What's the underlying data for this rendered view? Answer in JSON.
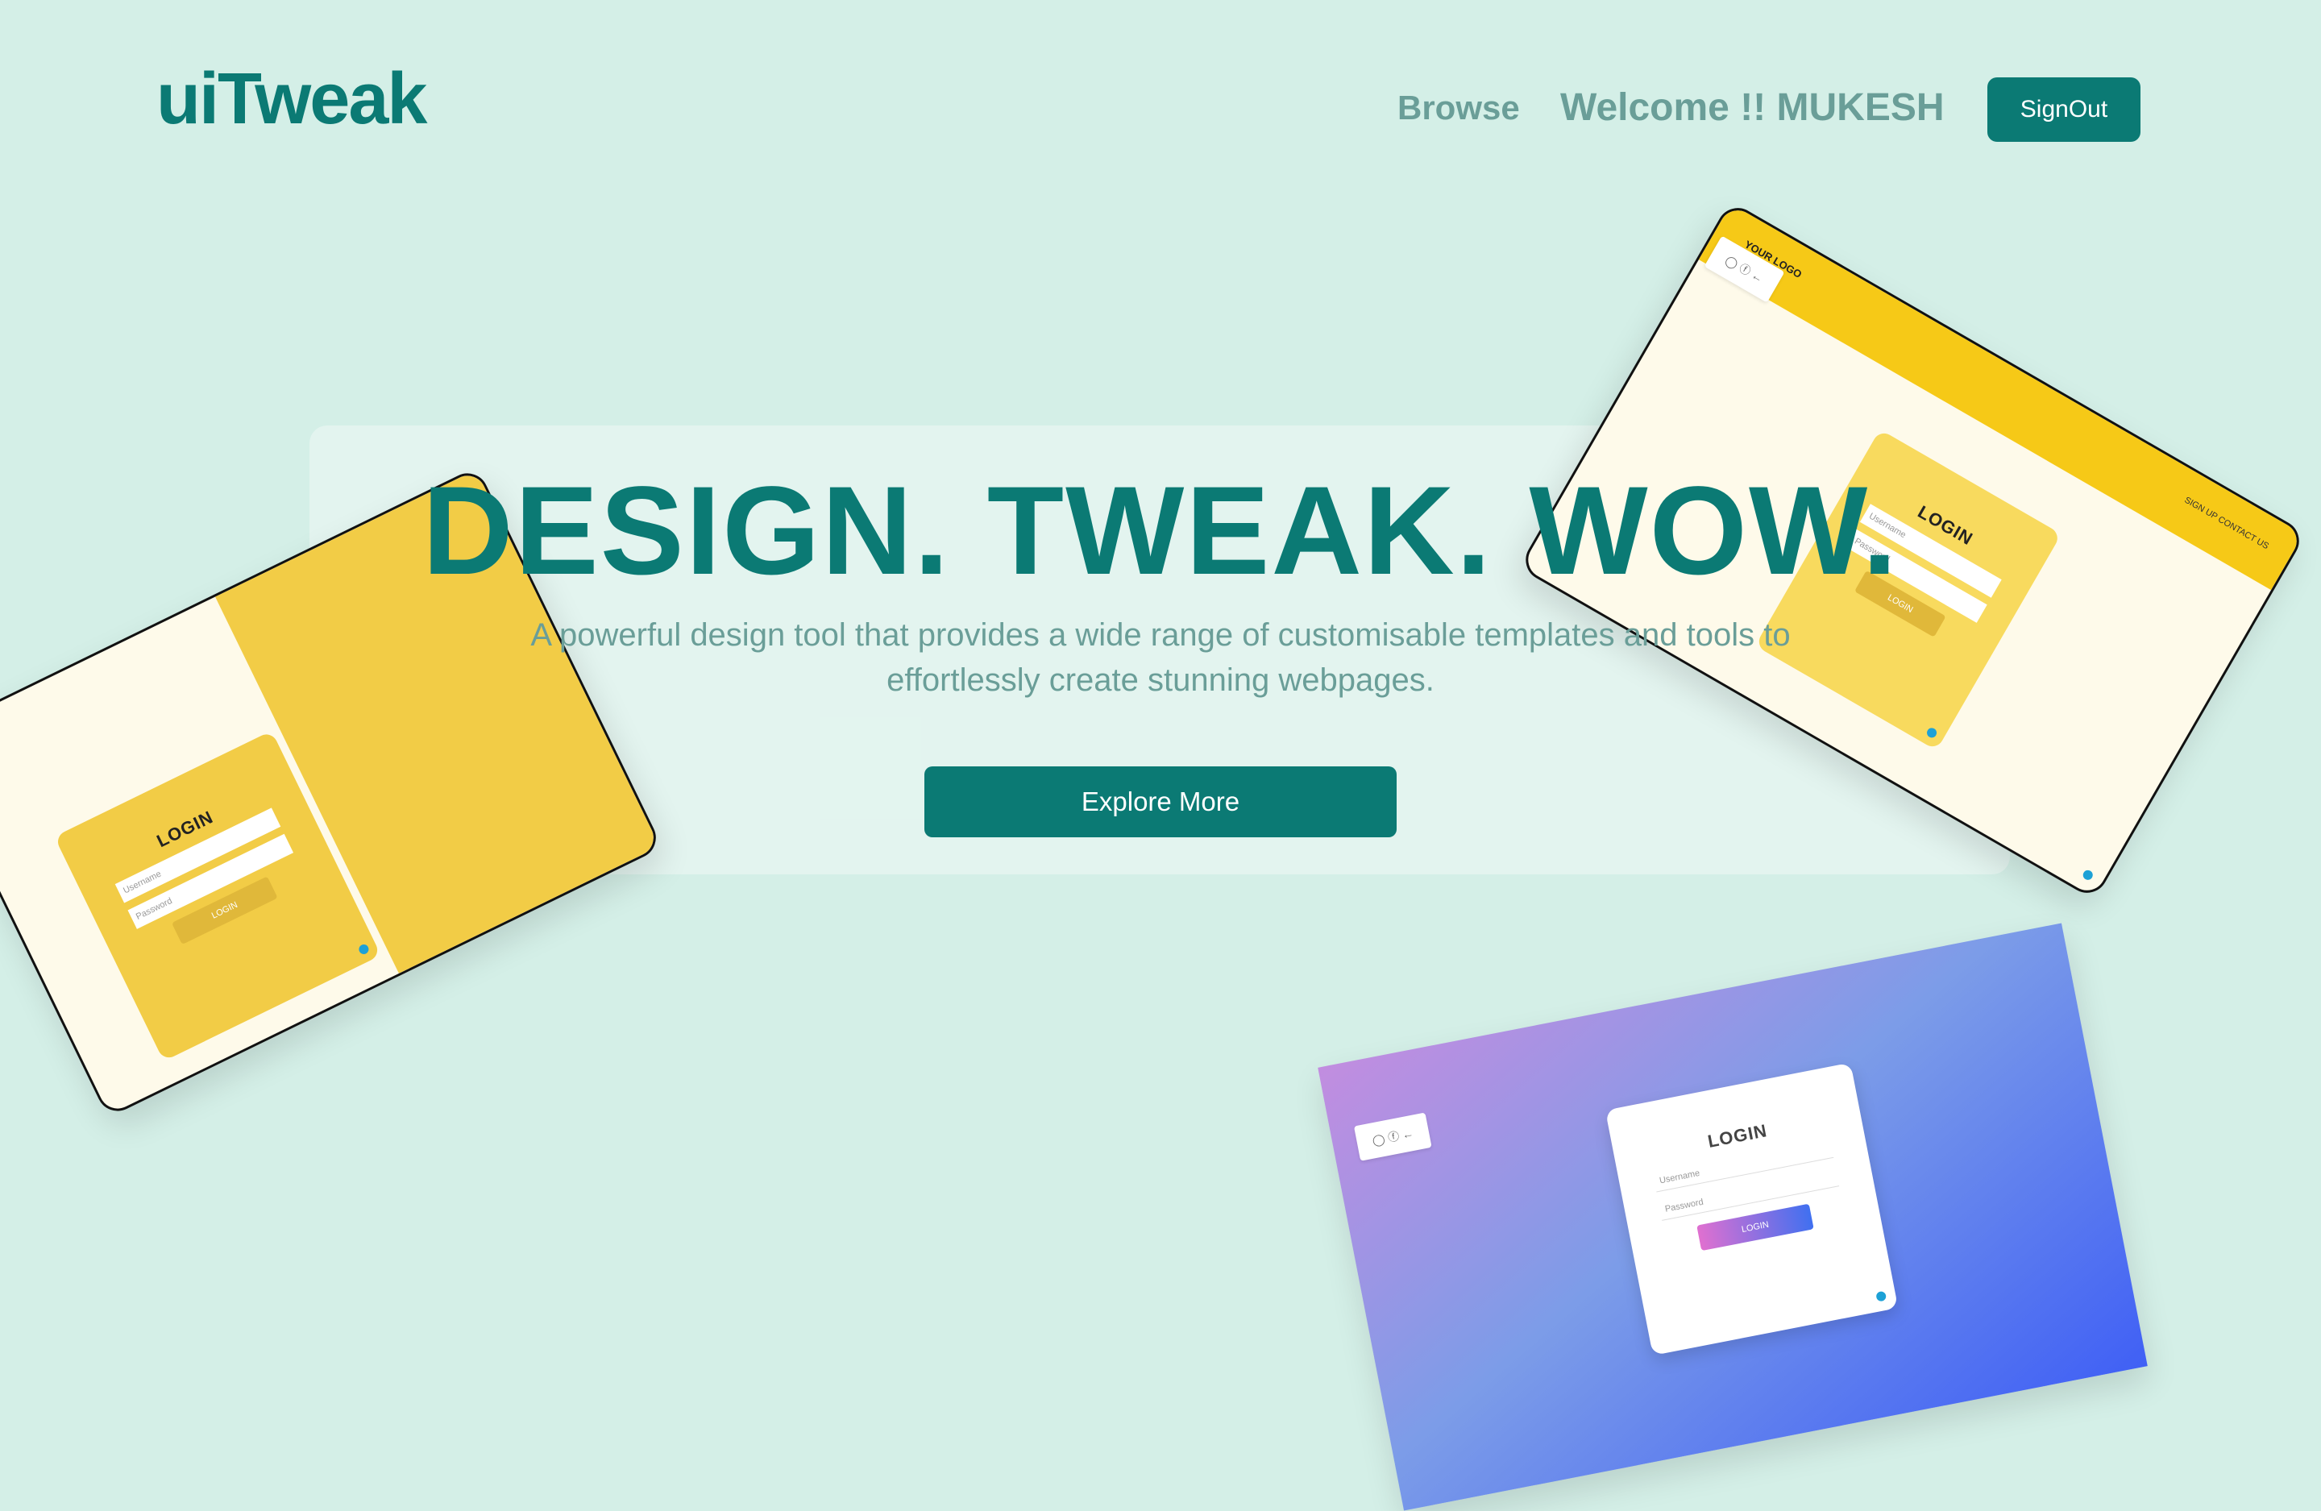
{
  "header": {
    "logo": "uiTweak",
    "nav_browse": "Browse",
    "welcome": "Welcome !! MUKESH",
    "signout_label": "SignOut"
  },
  "hero": {
    "title": "DESIGN. TWEAK. WOW.",
    "subtitle": "A powerful design tool that provides a wide range of customisable templates and tools to effortlessly create stunning webpages.",
    "cta_label": "Explore More"
  },
  "previews": {
    "login_title": "LOGIN",
    "username_placeholder": "Username",
    "password_placeholder": "Password",
    "login_button": "LOGIN",
    "your_logo": "YOUR LOGO",
    "mini_nav": "SIGN UP  CONTACT US",
    "social_icons": [
      "circle-icon",
      "facebook-icon",
      "back-icon"
    ]
  },
  "colors": {
    "background": "#d4efe7",
    "brand": "#0b7a74",
    "muted": "#6a9e98",
    "yellow": "#f2cc46"
  }
}
